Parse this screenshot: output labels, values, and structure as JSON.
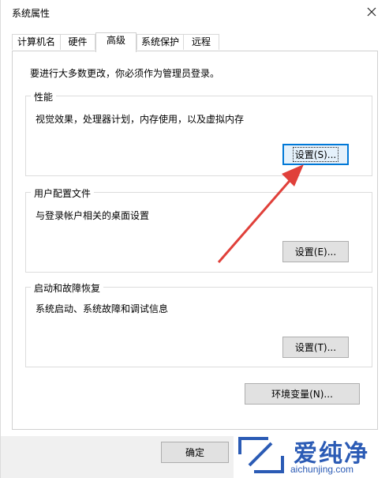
{
  "window": {
    "title": "系统属性"
  },
  "tabs": [
    {
      "label": "计算机名"
    },
    {
      "label": "硬件"
    },
    {
      "label": "高级"
    },
    {
      "label": "系统保护"
    },
    {
      "label": "远程"
    }
  ],
  "advanced": {
    "admin_note": "要进行大多数更改，你必须作为管理员登录。",
    "performance": {
      "title": "性能",
      "description": "视觉效果，处理器计划，内存使用，以及虚拟内存",
      "button": "设置(S)..."
    },
    "user_profiles": {
      "title": "用户配置文件",
      "description": "与登录帐户相关的桌面设置",
      "button": "设置(E)..."
    },
    "startup_recovery": {
      "title": "启动和故障恢复",
      "description": "系统启动、系统故障和调试信息",
      "button": "设置(T)..."
    },
    "env_button": "环境变量(N)..."
  },
  "footer": {
    "ok_button": "确定"
  },
  "watermark": {
    "brand": "爱纯净",
    "domain": "aichunjing.com"
  },
  "colors": {
    "arrow": "#e0403a",
    "focus": "#0078d7",
    "watermark": "#2b5bb5"
  }
}
